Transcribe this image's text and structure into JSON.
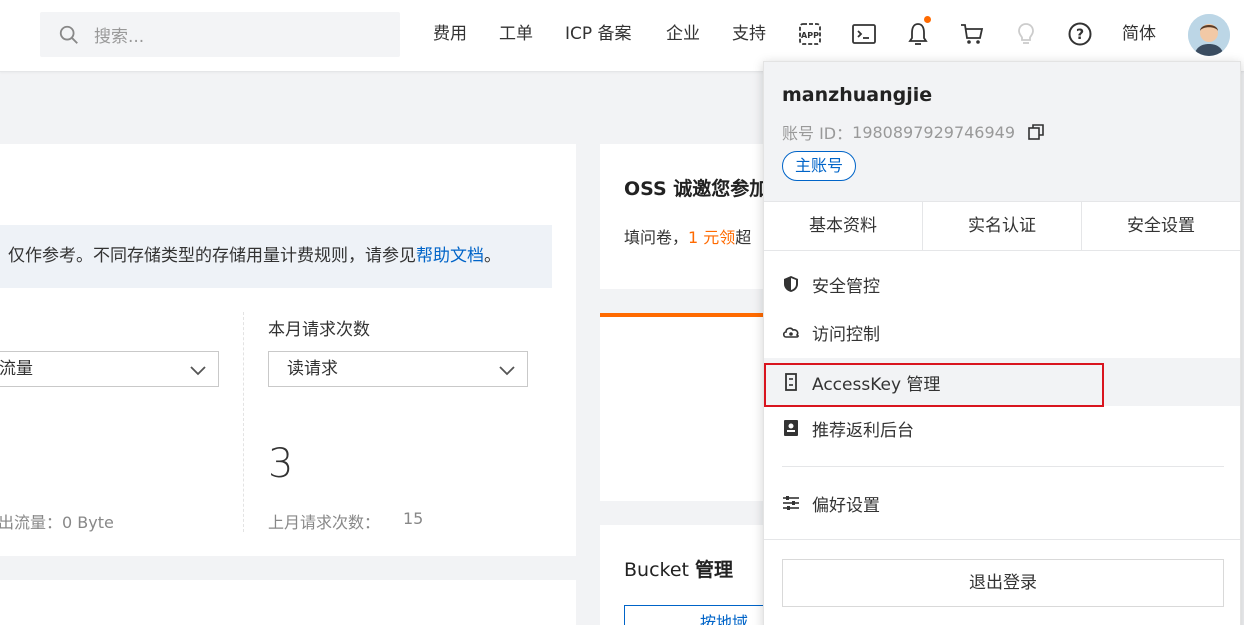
{
  "search": {
    "placeholder": "搜索..."
  },
  "nav": {
    "links": [
      "费用",
      "工单",
      "ICP 备案",
      "企业",
      "支持"
    ],
    "lang": "简体",
    "icons": [
      "app-icon",
      "terminal-icon",
      "bell-icon",
      "cart-icon",
      "bulb-icon",
      "help-icon"
    ],
    "accent": "#ff6a00"
  },
  "usage": {
    "notice_text": "仅作参考。不同存储类型的存储用量计费规则，请参见",
    "notice_link": "帮助文档",
    "notice_end": "。",
    "left_select": "流量",
    "left_sub": "出流量：0 Byte",
    "requests_label": "本月请求次数",
    "requests_select": "读请求",
    "requests_value": "3",
    "last_month_label": "上月请求次数：",
    "last_month_value": "15"
  },
  "promo": {
    "title": "OSS 诚邀您参加",
    "text_pre": "填问卷，",
    "text_highlight": "1 元领",
    "text_post": "超"
  },
  "bucket": {
    "title_pre": "Bucket ",
    "title_bold": "管理",
    "button": "按地域"
  },
  "account_panel": {
    "username": "manzhuangjie",
    "account_id_label": "账号 ID：",
    "account_id": "1980897929746949",
    "badge": "主账号",
    "tabs": [
      "基本资料",
      "实名认证",
      "安全设置"
    ],
    "menu": [
      {
        "label": "安全管控",
        "icon": "shield-icon"
      },
      {
        "label": "访问控制",
        "icon": "cloud-icon"
      },
      {
        "label": "AccessKey 管理",
        "icon": "key-icon"
      },
      {
        "label": "推荐返利后台",
        "icon": "book-icon"
      }
    ],
    "preferences": "偏好设置",
    "logout": "退出登录",
    "highlight_color": "#d9141e",
    "link_color": "#0064c8"
  }
}
